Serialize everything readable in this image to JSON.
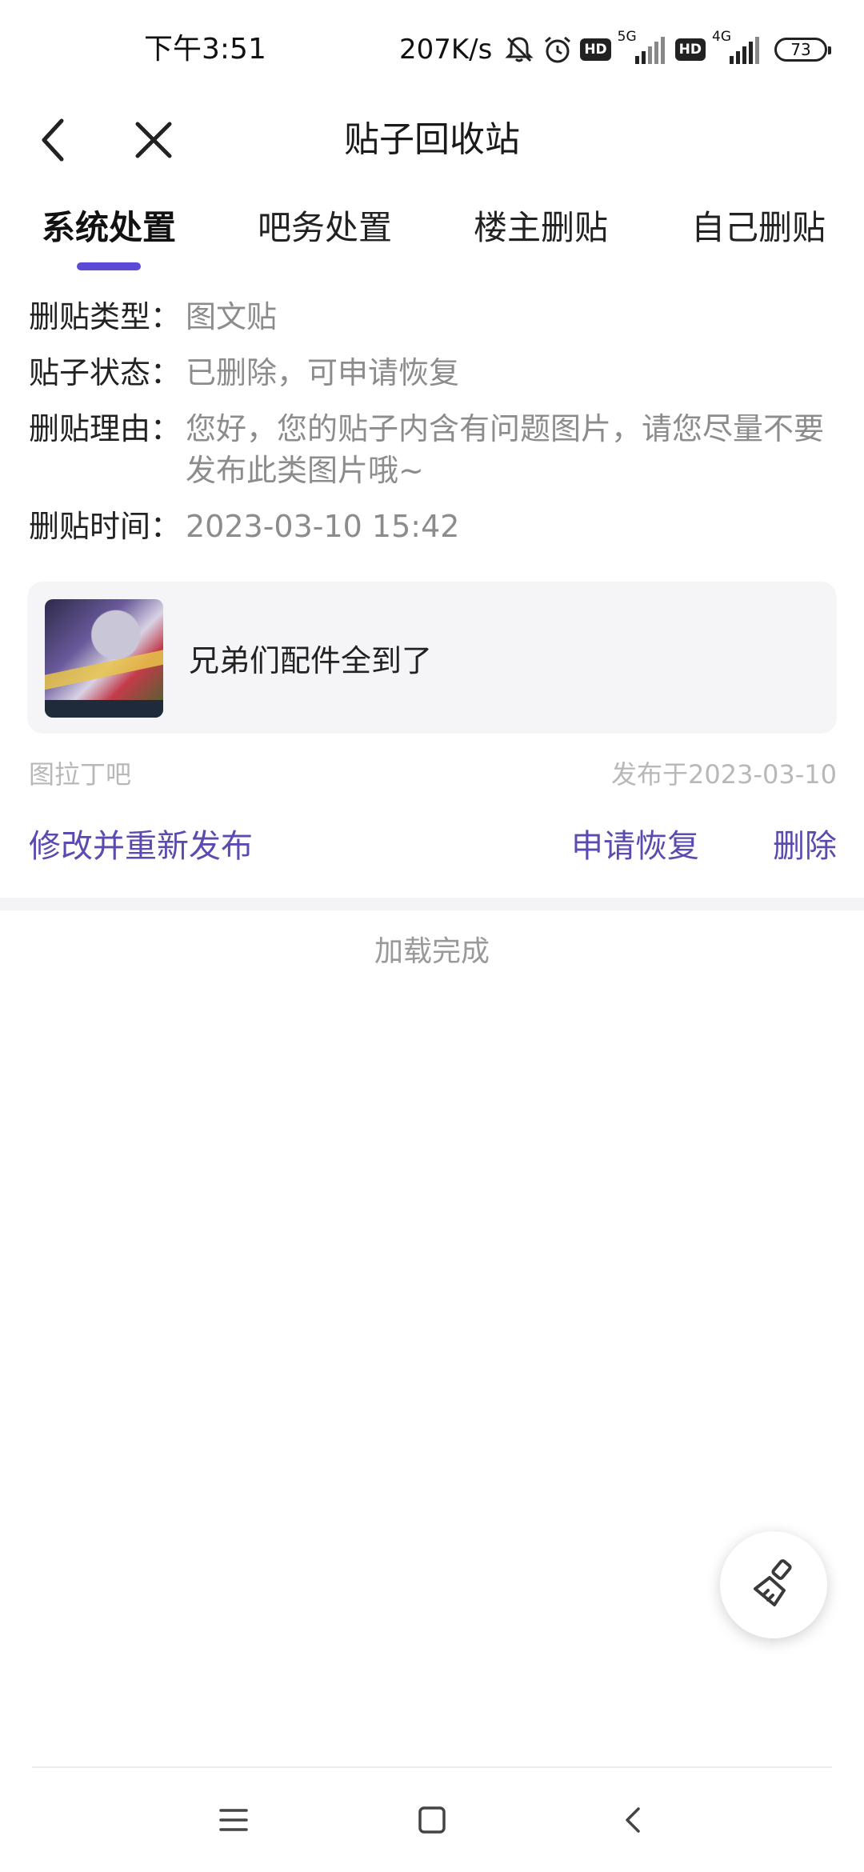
{
  "status_bar": {
    "time": "下午3:51",
    "net_speed": "207K/s",
    "hd1": "HD",
    "sig1_label": "5G",
    "hd2": "HD",
    "sig2_label": "4G",
    "battery": "73"
  },
  "header": {
    "title": "贴子回收站"
  },
  "tabs": [
    {
      "label": "系统处置",
      "active": true
    },
    {
      "label": "吧务处置",
      "active": false
    },
    {
      "label": "楼主删贴",
      "active": false
    },
    {
      "label": "自己删贴",
      "active": false
    }
  ],
  "info": {
    "type_label": "删贴类型：",
    "type_value": "图文贴",
    "status_label": "贴子状态：",
    "status_value": "已删除，可申请恢复",
    "reason_label": "删贴理由：",
    "reason_value": "您好，您的贴子内含有问题图片，请您尽量不要发布此类图片哦~",
    "time_label": "删贴时间：",
    "time_value": "2023-03-10 15:42"
  },
  "post": {
    "title": "兄弟们配件全到了",
    "forum": "图拉丁吧",
    "published": "发布于2023-03-10"
  },
  "actions": {
    "edit_republish": "修改并重新发布",
    "request_restore": "申请恢复",
    "delete": "删除"
  },
  "footer": {
    "loaded_text": "加载完成"
  },
  "colors": {
    "accent": "#5b4ad6",
    "action_text": "#5b4ab0"
  }
}
